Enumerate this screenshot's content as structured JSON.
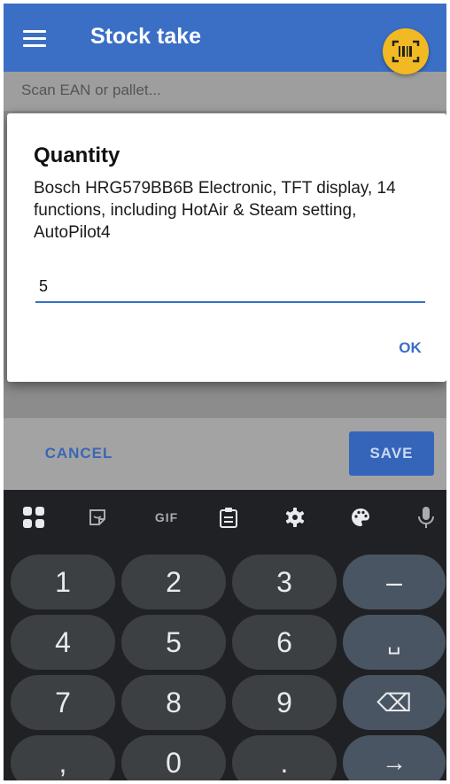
{
  "app_bar": {
    "title": "Stock take",
    "menu_icon": "hamburger-icon",
    "scan_icon": "barcode-scan-icon"
  },
  "scan": {
    "placeholder": "Scan EAN or pallet..."
  },
  "dialog": {
    "title": "Quantity",
    "description": "Bosch HRG579BB6B Electronic, TFT display, 14 functions, including HotAir & Steam setting, AutoPilot4",
    "quantity": "5",
    "ok_label": "OK"
  },
  "actions": {
    "cancel_label": "CANCEL",
    "save_label": "SAVE"
  },
  "keyboard": {
    "toolbar": {
      "gif_label": "GIF"
    },
    "rows": [
      [
        "1",
        "2",
        "3",
        "–"
      ],
      [
        "4",
        "5",
        "6",
        "␣"
      ],
      [
        "7",
        "8",
        "9",
        "⌫"
      ],
      [
        ",",
        "0",
        ".",
        "→"
      ]
    ]
  },
  "colors": {
    "primary": "#3b6fc6",
    "accent": "#f2b922",
    "keyboard_bg": "#202124"
  }
}
